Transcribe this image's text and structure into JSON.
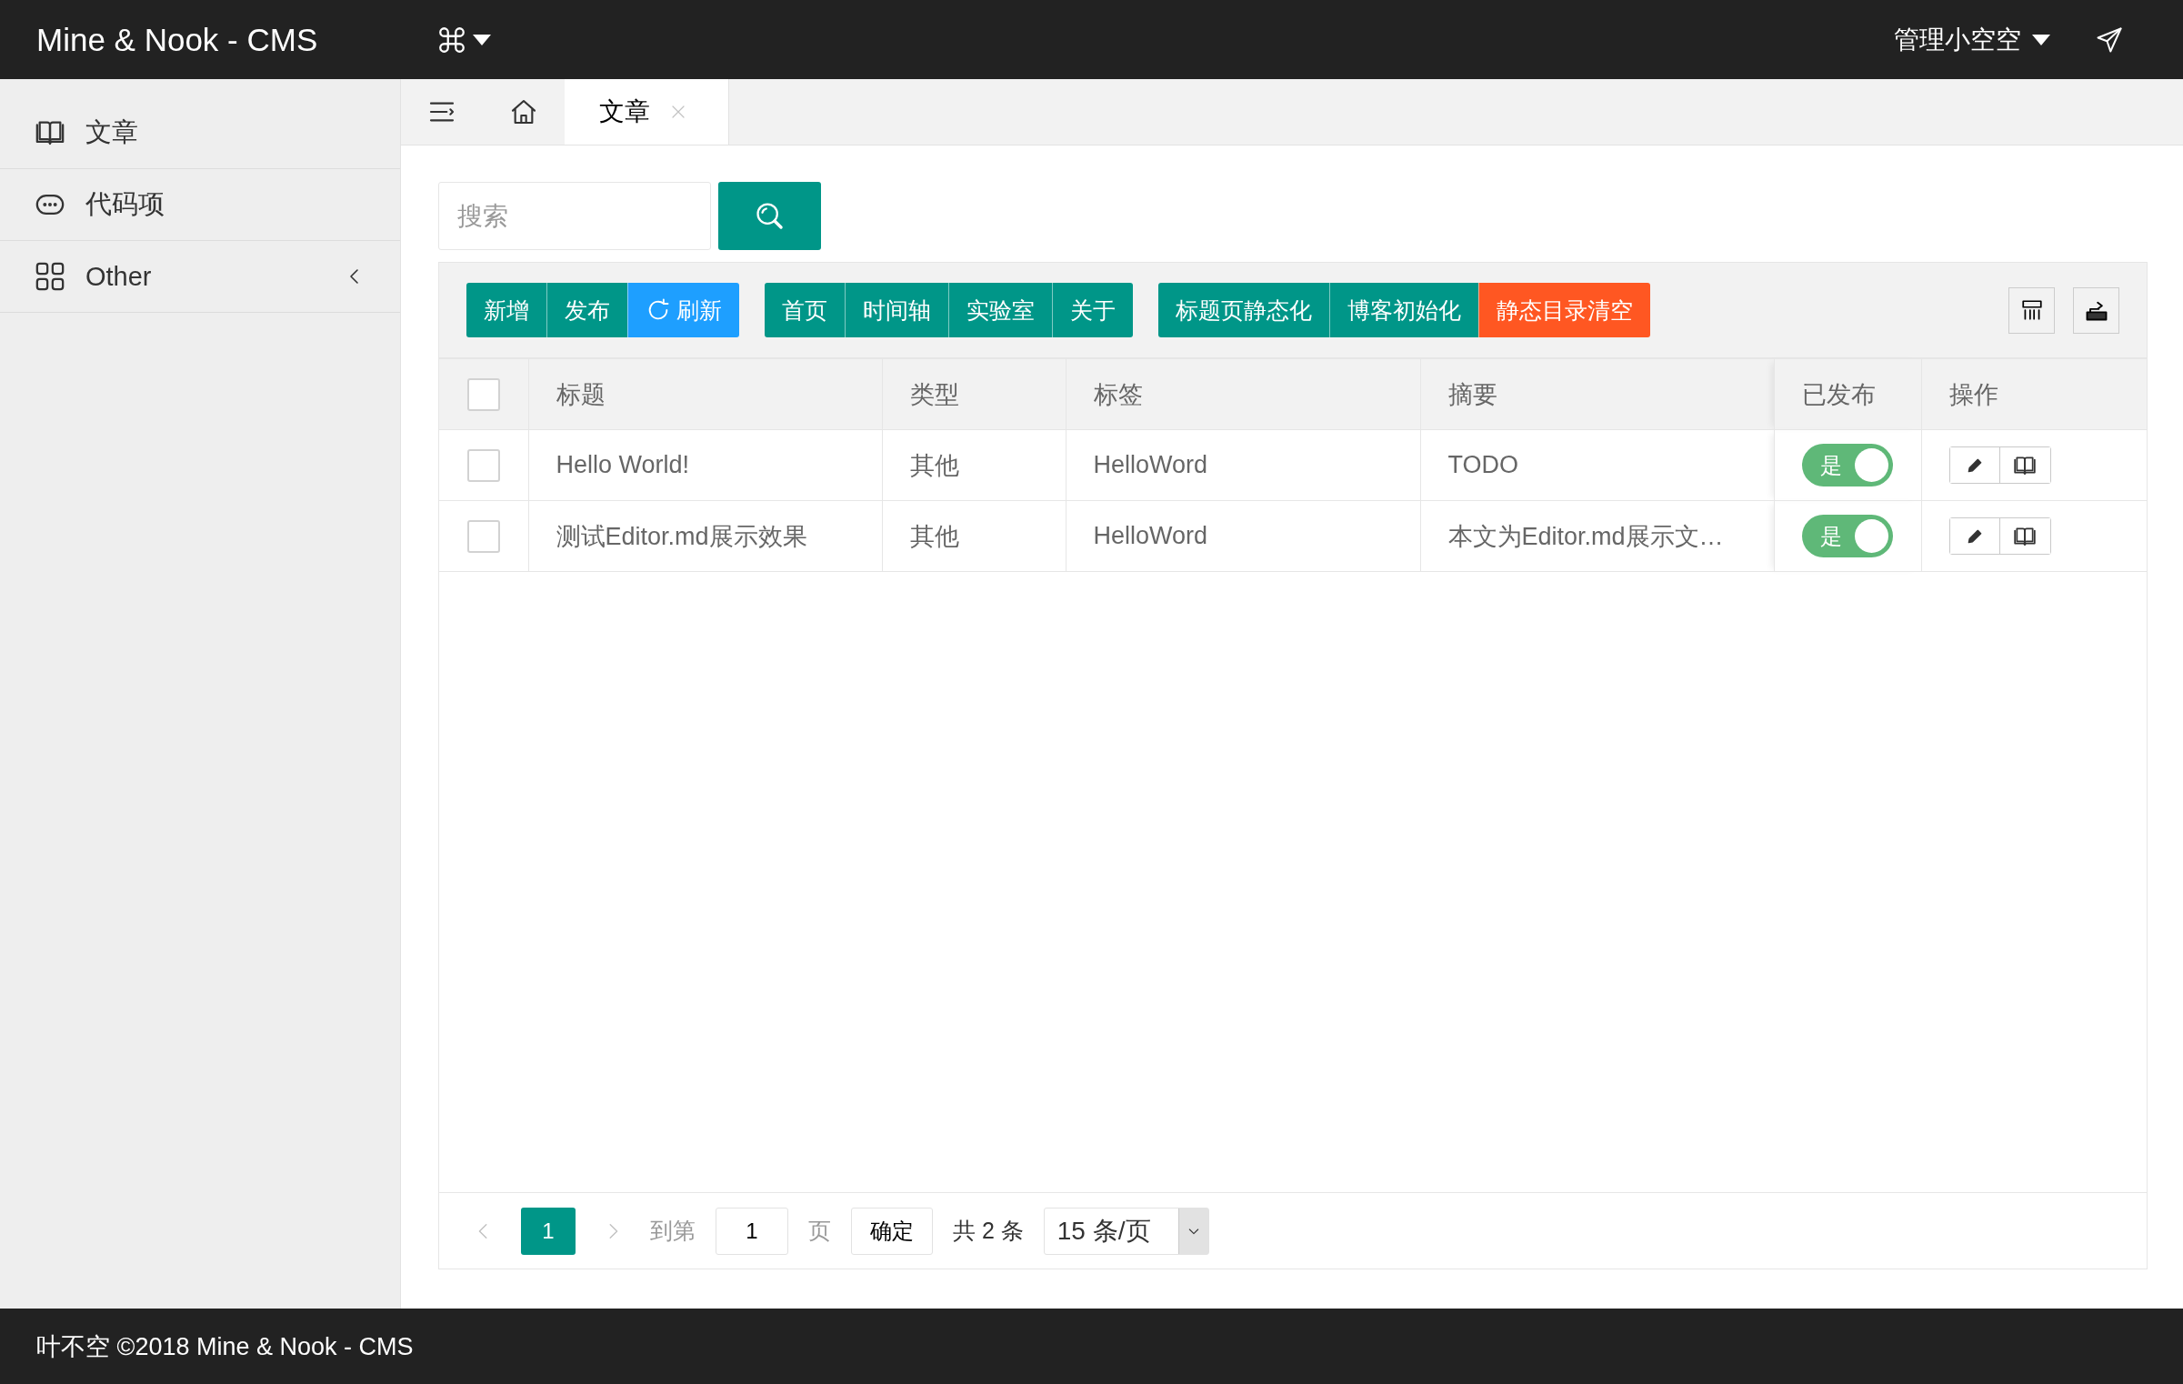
{
  "header": {
    "title": "Mine & Nook - CMS",
    "user": "管理小空空"
  },
  "sidebar": {
    "items": [
      {
        "label": "文章",
        "kind": "link",
        "selected": false
      },
      {
        "label": "代码项",
        "kind": "link",
        "selected": false
      },
      {
        "label": "Other",
        "kind": "group",
        "selected": false,
        "expanded": false
      }
    ]
  },
  "tabs": [
    {
      "label": "文章",
      "selected": true
    }
  ],
  "search": {
    "placeholder": "搜索"
  },
  "toolbar": {
    "groups": [
      [
        {
          "label": "新增",
          "color": "#009688",
          "kind": "plain"
        },
        {
          "label": "发布",
          "color": "#009688",
          "kind": "plain"
        },
        {
          "label": "刷新",
          "color": "#1e9fff",
          "kind": "refresh"
        }
      ],
      [
        {
          "label": "首页",
          "color": "#009688",
          "kind": "plain"
        },
        {
          "label": "时间轴",
          "color": "#009688",
          "kind": "plain"
        },
        {
          "label": "实验室",
          "color": "#009688",
          "kind": "plain"
        },
        {
          "label": "关于",
          "color": "#009688",
          "kind": "plain"
        }
      ],
      [
        {
          "label": "标题页静态化",
          "color": "#009688",
          "kind": "plain"
        },
        {
          "label": "博客初始化",
          "color": "#009688",
          "kind": "plain"
        },
        {
          "label": "静态目录清空",
          "color": "#ff5722",
          "kind": "plain"
        }
      ]
    ]
  },
  "table": {
    "all_checked": false,
    "columns": [
      "标题",
      "类型",
      "标签",
      "摘要",
      "已发布",
      "操作"
    ],
    "rows": [
      {
        "checked": false,
        "cells": [
          "Hello World!",
          "其他",
          "HelloWord",
          "TODO"
        ],
        "published": {
          "label": "是",
          "on": true
        }
      },
      {
        "checked": false,
        "cells": [
          "测试Editor.md展示效果",
          "其他",
          "HelloWord",
          "本文为Editor.md展示文…"
        ],
        "published": {
          "label": "是",
          "on": true
        }
      }
    ]
  },
  "pagination": {
    "pages": [
      {
        "label": "1",
        "selected": true
      }
    ],
    "goto_label": "到第",
    "goto_value": "1",
    "page_label": "页",
    "confirm": "确定",
    "total": "共 2 条",
    "page_size": "15 条/页"
  },
  "footer": {
    "text": "叶不空 ©2018 Mine & Nook - CMS"
  }
}
